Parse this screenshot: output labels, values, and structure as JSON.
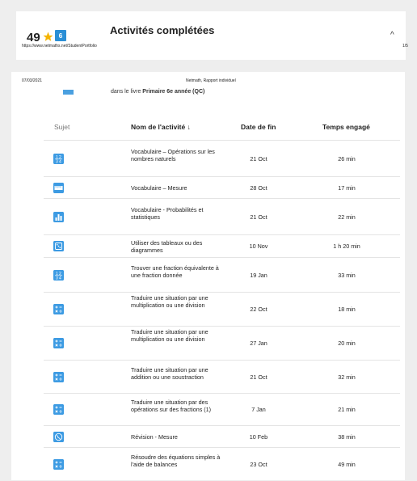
{
  "top_page": {
    "score": "49",
    "badge": "6",
    "title": "Activités complétées",
    "chevron": "^",
    "url": "https://www.netmaths.net/StudentPortfolio",
    "page": "1/5"
  },
  "report_header": {
    "date": "07/03/2021",
    "title": "Netmath, Rapport individuel"
  },
  "book_line": {
    "prefix": "dans le livre ",
    "book": "Primaire 6e année (QC)"
  },
  "table": {
    "headers": {
      "subject": "Sujet",
      "name": "Nom de l'activité ↓",
      "date": "Date de fin",
      "time": "Temps engagé"
    },
    "rows": [
      {
        "icon": "fractions-icon",
        "name": "Vocabulaire – Opérations sur les nombres naturels",
        "date": "21 Oct",
        "time": "26 min"
      },
      {
        "icon": "ruler-icon",
        "name": "Vocabulaire – Mesure",
        "date": "28 Oct",
        "time": "17 min"
      },
      {
        "icon": "bar-chart-icon",
        "name": "Vocabulaire - Probabilités et statistiques",
        "date": "21 Oct",
        "time": "22 min"
      },
      {
        "icon": "dice-icon",
        "name": "Utiliser des tableaux ou des diagrammes",
        "date": "10 Nov",
        "time": "1 h 20 min"
      },
      {
        "icon": "fractions-icon",
        "name": "Trouver une fraction équivalente à une fraction donnée",
        "date": "19 Jan",
        "time": "33 min"
      },
      {
        "icon": "operations-icon",
        "name": "Traduire une situation par une multiplication ou une division",
        "date": "22 Oct",
        "time": "18 min"
      },
      {
        "icon": "operations-icon",
        "name": "Traduire une situation par une multiplication ou une division",
        "date": "27 Jan",
        "time": "20 min"
      },
      {
        "icon": "operations-icon",
        "name": "Traduire une situation par une addition ou une soustraction",
        "date": "21 Oct",
        "time": "32 min"
      },
      {
        "icon": "operations-icon",
        "name": "Traduire une situation par des opérations sur des fractions (1)",
        "date": "7 Jan",
        "time": "21 min"
      },
      {
        "icon": "globe-icon",
        "name": "Révision - Mesure",
        "date": "10 Feb",
        "time": "38 min"
      },
      {
        "icon": "operations-icon",
        "name": "Résoudre des équations simples à l'aide de balances",
        "date": "23 Oct",
        "time": "49 min"
      }
    ]
  }
}
